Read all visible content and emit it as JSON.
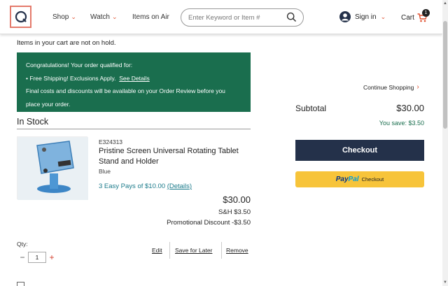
{
  "header": {
    "nav": {
      "shop": "Shop",
      "watch": "Watch",
      "items_on_air": "Items on Air"
    },
    "search": {
      "placeholder": "Enter Keyword or Item #"
    },
    "signin": "Sign in",
    "cart": {
      "label": "Cart",
      "count": "1"
    }
  },
  "notice": {
    "hold": "Items in your cart are not on hold."
  },
  "promo": {
    "line1": "Congratulations! Your order qualified for:",
    "bullet": "• Free Shipping! Exclusions Apply.",
    "see_details": "See Details",
    "line3": "Final costs and discounts will be available on your Order Review before you",
    "line4": "place your order."
  },
  "section": {
    "in_stock": "In Stock"
  },
  "item": {
    "id": "E324313",
    "name": "Pristine Screen Universal Rotating Tablet Stand and Holder",
    "color": "Blue",
    "easy_pay": "3 Easy Pays of $10.00",
    "easy_pay_details": "(Details)",
    "price": "$30.00",
    "sh": "S&H $3.50",
    "promo_discount": "Promotional Discount -$3.50",
    "qty_label": "Qty:",
    "qty": "1",
    "edit": "Edit",
    "save_for_later": "Save for Later",
    "remove": "Remove"
  },
  "summary": {
    "continue_shopping": "Continue Shopping",
    "subtotal_label": "Subtotal",
    "subtotal_value": "$30.00",
    "you_save": "You save: $3.50",
    "checkout": "Checkout",
    "paypal_pay": "Pay",
    "paypal_pal": "Pal",
    "paypal_checkout": "Checkout"
  },
  "colors": {
    "accent_orange": "#e0502f",
    "promo_green": "#1a6e4e",
    "checkout_navy": "#24314a",
    "paypal_yellow": "#f7c43a",
    "link_teal": "#1a7a8a"
  }
}
